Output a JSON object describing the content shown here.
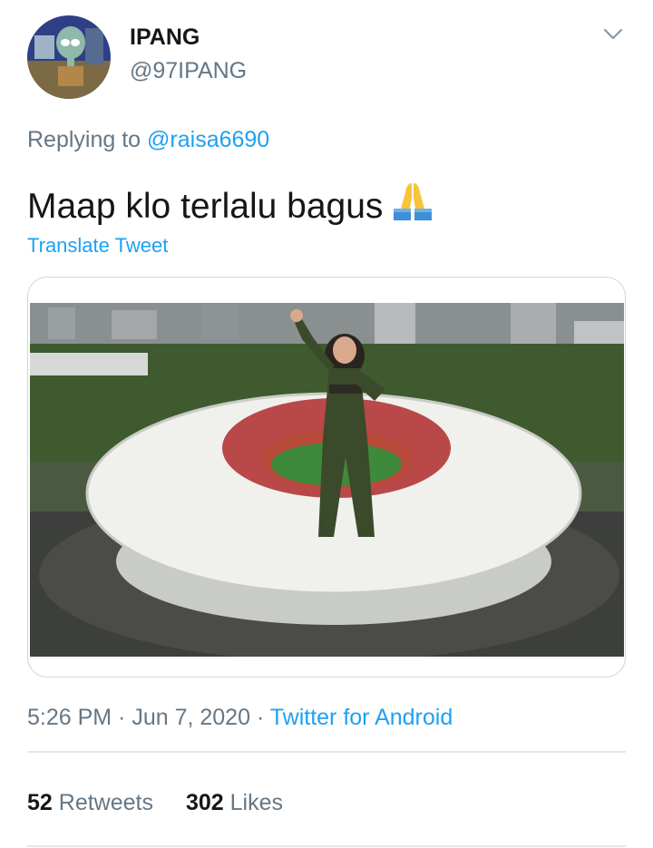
{
  "user": {
    "name": "IPANG",
    "handle": "@97IPANG"
  },
  "reply": {
    "prefix": "Replying to ",
    "mention": "@raisa6690"
  },
  "tweet": {
    "text": "Maap klo terlalu bagus",
    "emoji": "folded-hands"
  },
  "translate_label": "Translate Tweet",
  "meta": {
    "time": "5:26 PM",
    "sep1": " · ",
    "date": "Jun 7, 2020",
    "sep2": " · ",
    "source": "Twitter for Android"
  },
  "stats": {
    "retweets_count": "52",
    "retweets_label": " Retweets",
    "likes_count": "302",
    "likes_label": " Likes"
  },
  "colors": {
    "link": "#1da1f2",
    "secondary_text": "#657786",
    "primary_text": "#14171a",
    "border": "#ccd6dd"
  }
}
